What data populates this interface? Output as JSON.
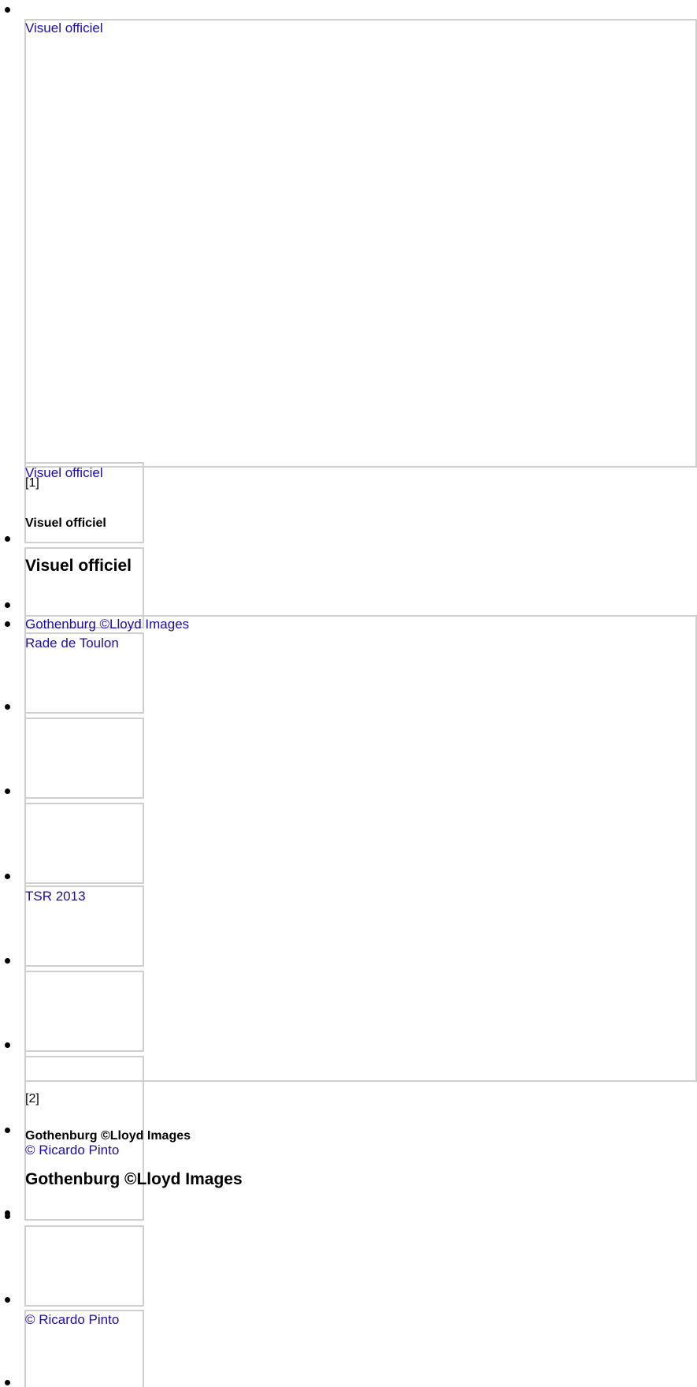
{
  "slider1": {
    "main_link": "Visuel officiel",
    "thumb_link": "Visuel officiel",
    "ref": "[1]",
    "caption_small": "Visuel officiel",
    "caption": "Visuel officiel"
  },
  "slider2": {
    "main_link": "Gothenburg ©Lloyd Images",
    "thumb_links": [
      "Rade de Toulon",
      "TSR 2013",
      "© Ricardo Pinto",
      "© Ricardo Pinto"
    ],
    "ref": "[2]",
    "caption_small": "Gothenburg ©Lloyd Images",
    "caption": "Gothenburg ©Lloyd Images"
  }
}
